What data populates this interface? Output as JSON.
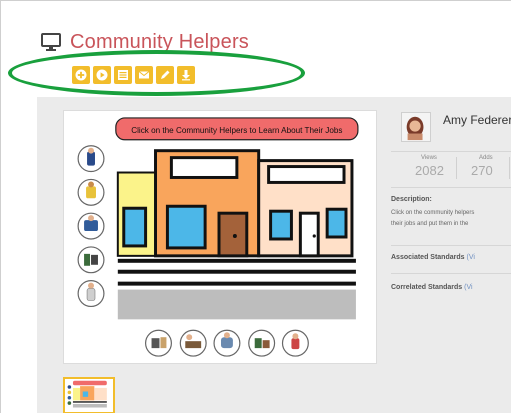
{
  "header": {
    "title": "Community Helpers",
    "icon": "monitor-icon"
  },
  "toolbar": {
    "buttons": [
      {
        "name": "add-button",
        "icon": "plus-circle-icon"
      },
      {
        "name": "play-button",
        "icon": "play-circle-icon"
      },
      {
        "name": "list-button",
        "icon": "list-icon"
      },
      {
        "name": "email-button",
        "icon": "envelope-icon"
      },
      {
        "name": "edit-button",
        "icon": "pencil-icon"
      },
      {
        "name": "download-button",
        "icon": "download-icon"
      }
    ],
    "color": "#f2bd2b",
    "highlight_color": "#19a03d"
  },
  "activity": {
    "banner": "Click on the Community Helpers to Learn About Their Jobs",
    "banner_color": "#f06b6b"
  },
  "author": {
    "name": "Amy Federer"
  },
  "stats": {
    "views_label": "Views",
    "views": "2082",
    "adds_label": "Adds",
    "adds": "270"
  },
  "description": {
    "title": "Description:",
    "line1": "Click on the community helpers",
    "line2": "their jobs and put them in the"
  },
  "standards": {
    "associated": "Associated Standards",
    "associated_link": "(Vi",
    "correlated": "Correlated Standards",
    "correlated_link": "(Vi"
  },
  "colors": {
    "title": "#c9545a",
    "content_bg": "#ebebeb"
  }
}
